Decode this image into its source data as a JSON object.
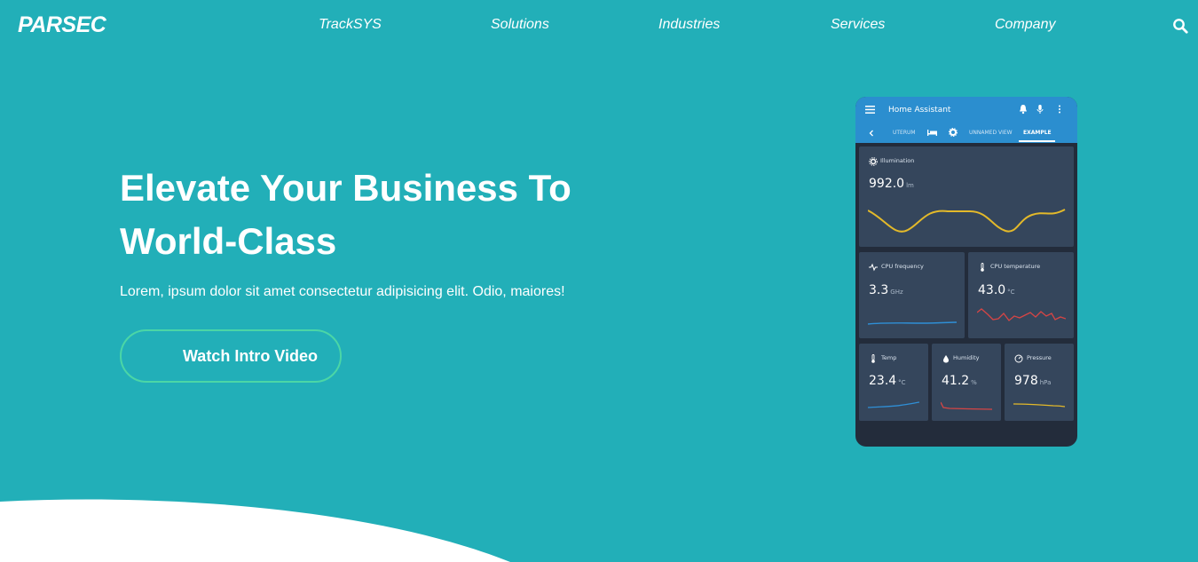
{
  "brand": {
    "logo": "PARSEC"
  },
  "nav": {
    "links": [
      "TrackSYS",
      "Solutions",
      "Industries",
      "Services",
      "Company"
    ]
  },
  "hero": {
    "title_line1": "Elevate Your Business To",
    "title_line2": "World-Class",
    "subtitle": "Lorem, ipsum dolor sit amet consectetur adipisicing elit. Odio, maiores!",
    "cta_label": "Watch Intro Video"
  },
  "mockup": {
    "app_title": "Home Assistant",
    "tabs": [
      "UTERUM",
      "UNNAMED VIEW",
      "EXAMPLE"
    ],
    "active_tab": "EXAMPLE",
    "cards": {
      "illumination": {
        "label": "Illumination",
        "value": "992.0",
        "unit": "lm",
        "color": "#e3b92a"
      },
      "cpu_freq": {
        "label": "CPU frequency",
        "value": "3.3",
        "unit": "GHz",
        "color": "#2f8fd6"
      },
      "cpu_temp": {
        "label": "CPU temperature",
        "value": "43.0",
        "unit": "°C",
        "color": "#d64545"
      },
      "temp": {
        "label": "Temp",
        "value": "23.4",
        "unit": "°C",
        "color": "#2f8fd6"
      },
      "humidity": {
        "label": "Humidity",
        "value": "41.2",
        "unit": "%",
        "color": "#d64545"
      },
      "pressure": {
        "label": "Pressure",
        "value": "978",
        "unit": "hPa",
        "color": "#e3b92a"
      }
    }
  },
  "colors": {
    "background": "#22afb8",
    "cta_border": "#4bd6a6",
    "mockup_header": "#2b8ecf",
    "mockup_card": "#35465c"
  }
}
